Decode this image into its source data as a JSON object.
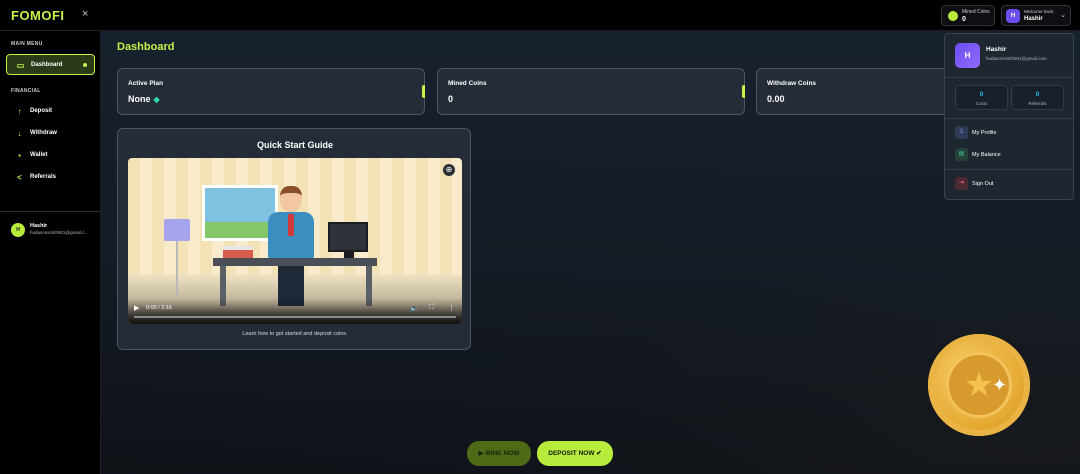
{
  "topbar": {
    "logo": "FOMOFI",
    "close_symbol": "×",
    "mined_coins_label": "Mined Coins",
    "mined_coins_value": "0",
    "welcome_label": "Welcome back,",
    "welcome_name": "Hashir",
    "avatar_initial": "H"
  },
  "sidebar": {
    "main_menu_title": "MAIN MENU",
    "financial_title": "FINANCIAL",
    "items": [
      {
        "label": "Dashboard",
        "icon": "monitor-icon"
      },
      {
        "label": "Deposit",
        "icon": "arrow-up-icon"
      },
      {
        "label": "Withdraw",
        "icon": "arrow-down-icon"
      },
      {
        "label": "Wallet",
        "icon": "wallet-icon"
      },
      {
        "label": "Referrals",
        "icon": "share-icon"
      }
    ],
    "user": {
      "initial": "H",
      "name": "Hashir",
      "email": "hudasonsmith901@gmail.c..."
    }
  },
  "main": {
    "title": "Dashboard",
    "cards": [
      {
        "label": "Active Plan",
        "value": "None"
      },
      {
        "label": "Mined Coins",
        "value": "0"
      },
      {
        "label": "Withdraw Coins",
        "value": "0.00"
      }
    ],
    "guide": {
      "title": "Quick Start Guide",
      "time": "0:00 / 2:16",
      "caption": "Learn how to get started and deposit coins."
    },
    "buttons": {
      "mine": "MINE NOW",
      "deposit": "DEPOSIT NOW"
    }
  },
  "dropdown": {
    "initial": "H",
    "name": "Hashir",
    "email": "hudasonsmith901@gmail.com",
    "stats": [
      {
        "value": "0",
        "label": "Coins"
      },
      {
        "value": "0",
        "label": "Referrals"
      }
    ],
    "items": [
      {
        "label": "My Profile",
        "icon": "user-icon"
      },
      {
        "label": "My Balance",
        "icon": "wallet-icon"
      },
      {
        "label": "Sign Out",
        "icon": "sign-out-icon"
      }
    ]
  },
  "colors": {
    "accent": "#c6f14a",
    "stat_value": "#23c2e8",
    "avatar": "#6b4df0"
  }
}
